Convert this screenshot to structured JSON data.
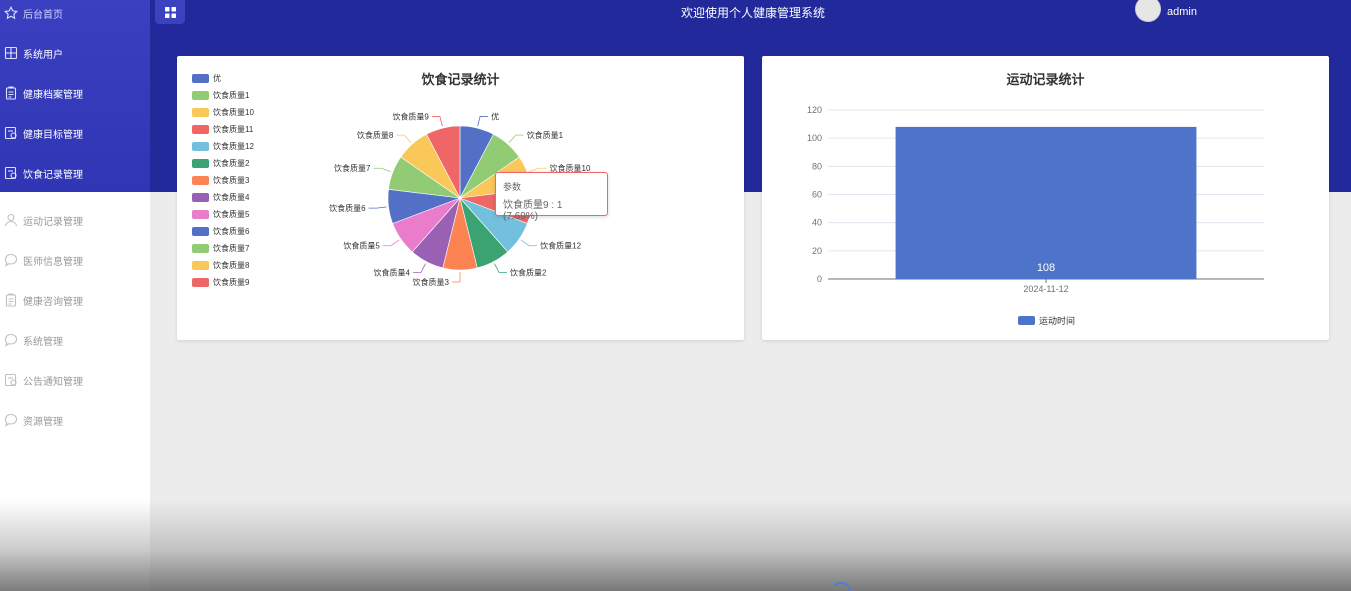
{
  "header": {
    "title": "欢迎使用个人健康管理系统",
    "username": "admin"
  },
  "sidebar": {
    "items": [
      {
        "label": "后台首页",
        "icon": "star-icon"
      },
      {
        "label": "系统用户",
        "icon": "grid-icon"
      },
      {
        "label": "健康档案管理",
        "icon": "clipboard-icon"
      },
      {
        "label": "健康目标管理",
        "icon": "clipboard-edit-icon"
      },
      {
        "label": "饮食记录管理",
        "icon": "clipboard-edit-icon"
      },
      {
        "label": "运动记录管理",
        "icon": "user-icon"
      },
      {
        "label": "医师信息管理",
        "icon": "chat-icon"
      },
      {
        "label": "健康咨询管理",
        "icon": "clipboard-icon"
      },
      {
        "label": "系统管理",
        "icon": "chat-icon"
      },
      {
        "label": "公告通知管理",
        "icon": "clipboard-edit-icon"
      },
      {
        "label": "资源管理",
        "icon": "chat-icon"
      }
    ]
  },
  "colors": {
    "header_bg": "#22299b",
    "sidebar_bg": "#3a40c0",
    "accent": "#4e74c9",
    "tooltip_border": "#ee6666"
  },
  "pie_card": {
    "title": "饮食记录统计",
    "tooltip": {
      "series": "参数",
      "text": "饮食质量9 : 1 (7.69%)"
    }
  },
  "bar_card": {
    "title": "运动记录统计"
  },
  "chart_data": [
    {
      "type": "pie",
      "title": "饮食记录统计",
      "labels": [
        "优",
        "饮食质量1",
        "饮食质量10",
        "饮食质量11",
        "饮食质量12",
        "饮食质量2",
        "饮食质量3",
        "饮食质量4",
        "饮食质量5",
        "饮食质量6",
        "饮食质量7",
        "饮食质量8",
        "饮食质量9"
      ],
      "values": [
        1,
        1,
        1,
        1,
        1,
        1,
        1,
        1,
        1,
        1,
        1,
        1,
        1
      ],
      "colors": [
        "#5470c6",
        "#91cc75",
        "#fac858",
        "#ee6666",
        "#73c0de",
        "#3ba272",
        "#fc8452",
        "#9a60b4",
        "#ea7ccc",
        "#5470c6",
        "#91cc75",
        "#fac858",
        "#ee6666"
      ],
      "legend": "left"
    },
    {
      "type": "bar",
      "title": "运动记录统计",
      "categories": [
        "2024-11-12"
      ],
      "series": [
        {
          "name": "运动时间",
          "values": [
            108
          ]
        }
      ],
      "ylim": [
        0,
        120
      ],
      "yticks": [
        0,
        20,
        40,
        60,
        80,
        100,
        120
      ],
      "grid": true,
      "legend": "bottom"
    }
  ]
}
